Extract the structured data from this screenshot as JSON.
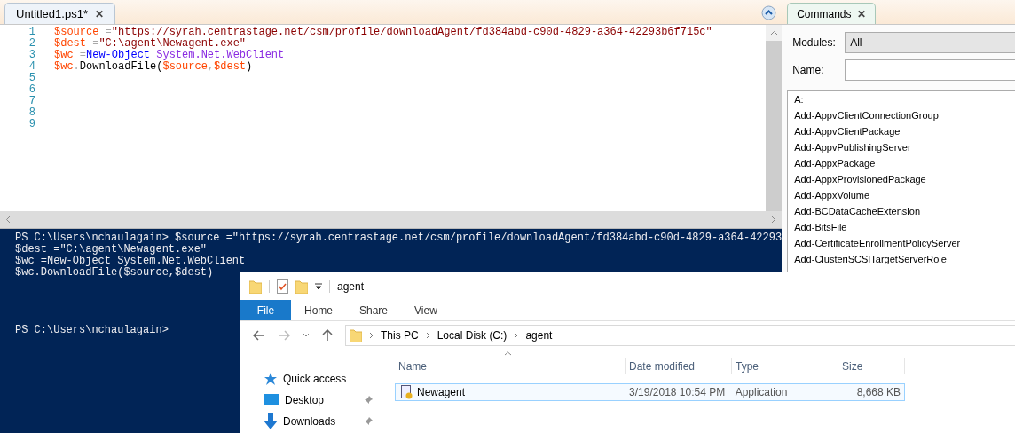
{
  "editor": {
    "tab": {
      "label": "Untitled1.ps1*",
      "close": "✕",
      "selected": true
    },
    "lines": [
      {
        "number": "1",
        "tokens": [
          {
            "kind": "variable",
            "text": "$source"
          },
          {
            "kind": "operator",
            "text": " ="
          },
          {
            "kind": "string",
            "text": "\"https://syrah.centrastage.net/csm/profile/downloadAgent/fd384abd-c90d-4829-a364-42293b6f715c\""
          }
        ]
      },
      {
        "number": "2",
        "tokens": [
          {
            "kind": "variable",
            "text": "$dest"
          },
          {
            "kind": "operator",
            "text": " ="
          },
          {
            "kind": "string",
            "text": "\"C:\\agent\\Newagent.exe\""
          }
        ]
      },
      {
        "number": "3",
        "tokens": [
          {
            "kind": "variable",
            "text": "$wc"
          },
          {
            "kind": "operator",
            "text": " ="
          },
          {
            "kind": "command",
            "text": "New-Object"
          },
          {
            "kind": "type",
            "text": " System.Net.WebClient"
          }
        ]
      },
      {
        "number": "4",
        "tokens": [
          {
            "kind": "variable",
            "text": "$wc"
          },
          {
            "kind": "operator",
            "text": "."
          },
          {
            "kind": "member",
            "text": "DownloadFile("
          },
          {
            "kind": "variable",
            "text": "$source"
          },
          {
            "kind": "operator",
            "text": ","
          },
          {
            "kind": "variable",
            "text": "$dest"
          },
          {
            "kind": "member",
            "text": ")"
          }
        ]
      },
      {
        "number": "5"
      },
      {
        "number": "6"
      },
      {
        "number": "7"
      },
      {
        "number": "8"
      },
      {
        "number": "9"
      }
    ]
  },
  "console": {
    "lines": [
      "PS C:\\Users\\nchaulagain> $source =\"https://syrah.centrastage.net/csm/profile/downloadAgent/fd384abd-c90d-4829-a364-42293",
      "$dest =\"C:\\agent\\Newagent.exe\"",
      "$wc =New-Object System.Net.WebClient",
      "$wc.DownloadFile($source,$dest)"
    ],
    "prompt": "PS C:\\Users\\nchaulagain>"
  },
  "commands": {
    "tab": {
      "label": "Commands",
      "close": "✕",
      "selected": true
    },
    "modules": {
      "label": "Modules:",
      "value": "All"
    },
    "name": {
      "label": "Name:"
    },
    "items": [
      "A:",
      "Add-AppvClientConnectionGroup",
      "Add-AppvClientPackage",
      "Add-AppvPublishingServer",
      "Add-AppxPackage",
      "Add-AppxProvisionedPackage",
      "Add-AppxVolume",
      "Add-BCDataCacheExtension",
      "Add-BitsFile",
      "Add-CertificateEnrollmentPolicyServer",
      "Add-ClusteriSCSITargetServerRole"
    ]
  },
  "explorer": {
    "title": "agent",
    "ribbon_tabs": [
      {
        "label": "File",
        "selected": true
      },
      {
        "label": "Home",
        "selected": false
      },
      {
        "label": "Share",
        "selected": false
      },
      {
        "label": "View",
        "selected": false
      }
    ],
    "breadcrumb": [
      "This PC",
      "Local Disk (C:)",
      "agent"
    ],
    "nav_items": [
      {
        "label": "Quick access",
        "kind": "star",
        "pinned": false
      },
      {
        "label": "Desktop",
        "kind": "desktop",
        "pinned": true
      },
      {
        "label": "Downloads",
        "kind": "download",
        "pinned": true
      }
    ],
    "columns": [
      "Name",
      "Date modified",
      "Type",
      "Size"
    ],
    "files": [
      {
        "name": "Newagent",
        "date": "3/19/2018 10:54 PM",
        "type": "Application",
        "size": "8,668 KB",
        "selected": true
      }
    ]
  }
}
